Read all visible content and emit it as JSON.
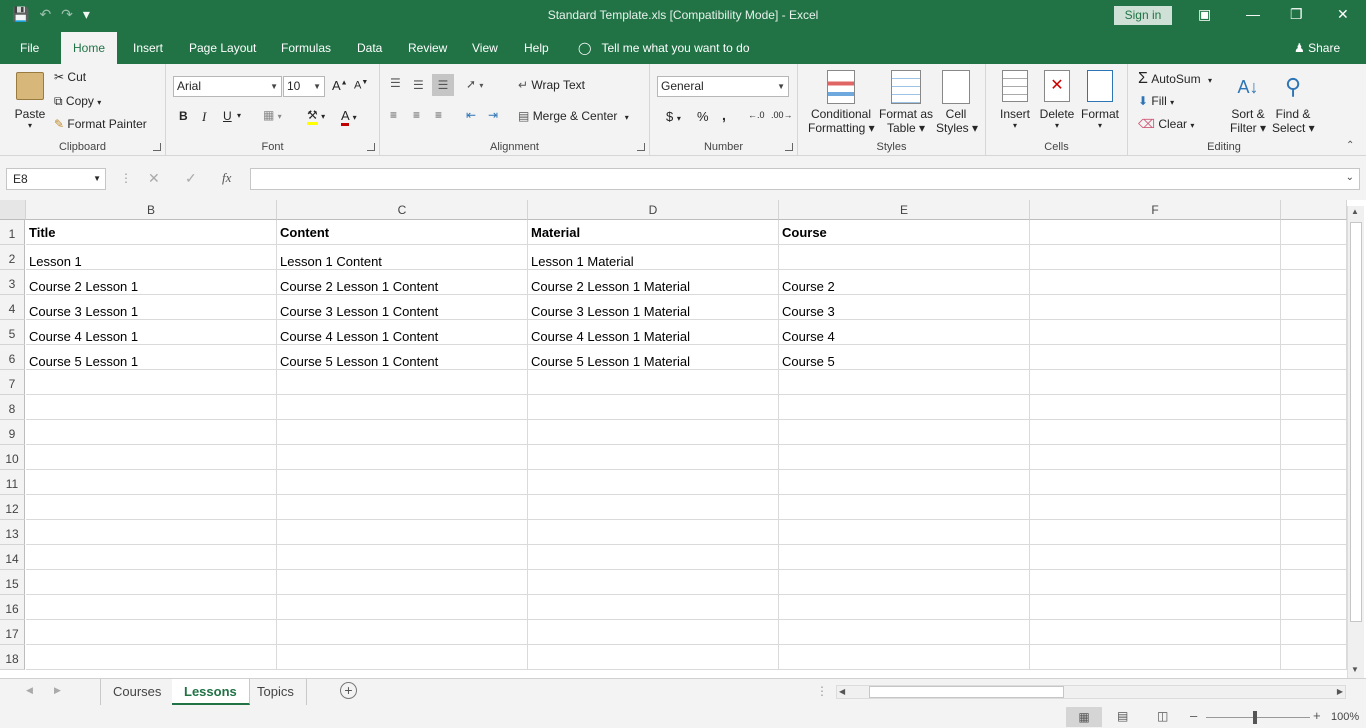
{
  "window": {
    "title": "Standard Template.xls  [Compatibility Mode]  -  Excel",
    "signin": "Sign in",
    "share": "Share",
    "accent": "#217346"
  },
  "qat": {
    "save_icon": "save-icon",
    "undo_icon": "undo-icon",
    "redo_icon": "redo-icon",
    "customize": "▾"
  },
  "menu_tabs": [
    "File",
    "Home",
    "Insert",
    "Page Layout",
    "Formulas",
    "Data",
    "Review",
    "View",
    "Help"
  ],
  "tell_me": "Tell me what you want to do",
  "ribbon": {
    "clipboard": {
      "label": "Clipboard",
      "paste": "Paste",
      "cut": "Cut",
      "copy": "Copy",
      "format_painter": "Format Painter"
    },
    "font": {
      "label": "Font",
      "name": "Arial",
      "size": "10",
      "bold": "B",
      "italic": "I",
      "underline": "U"
    },
    "alignment": {
      "label": "Alignment",
      "wrap_text": "Wrap Text",
      "merge_center": "Merge & Center"
    },
    "number": {
      "label": "Number",
      "format": "General",
      "currency": "$",
      "percent": "%",
      "comma": ","
    },
    "styles": {
      "label": "Styles",
      "conditional_formatting": [
        "Conditional",
        "Formatting ▾"
      ],
      "format_as_table": [
        "Format as",
        "Table ▾"
      ],
      "cell_styles": [
        "Cell",
        "Styles ▾"
      ]
    },
    "cells": {
      "label": "Cells",
      "insert": "Insert",
      "delete": "Delete",
      "format": "Format"
    },
    "editing": {
      "label": "Editing",
      "autosum": "AutoSum",
      "fill": "Fill",
      "clear": "Clear",
      "sort_filter": [
        "Sort &",
        "Filter ▾"
      ],
      "find_select": [
        "Find &",
        "Select ▾"
      ]
    }
  },
  "formula_bar": {
    "name_box": "E8",
    "formula": ""
  },
  "sheet": {
    "columns": [
      "B",
      "C",
      "D",
      "E",
      "F"
    ],
    "rows": [
      {
        "num": "1",
        "cells": [
          "Title",
          "Content",
          "Material",
          "Course",
          ""
        ]
      },
      {
        "num": "2",
        "cells": [
          "Lesson 1",
          "Lesson 1 Content",
          "Lesson 1 Material",
          "",
          ""
        ]
      },
      {
        "num": "3",
        "cells": [
          "Course 2 Lesson 1",
          "Course 2 Lesson 1 Content",
          "Course 2 Lesson 1 Material",
          "Course 2",
          ""
        ]
      },
      {
        "num": "4",
        "cells": [
          "Course 3 Lesson 1",
          "Course 3 Lesson 1 Content",
          "Course 3 Lesson 1 Material",
          "Course 3",
          ""
        ]
      },
      {
        "num": "5",
        "cells": [
          "Course 4 Lesson 1",
          "Course 4 Lesson 1 Content",
          "Course 4 Lesson 1 Material",
          "Course 4",
          ""
        ]
      },
      {
        "num": "6",
        "cells": [
          "Course 5 Lesson 1",
          "Course 5 Lesson 1 Content",
          "Course 5 Lesson 1 Material",
          "Course 5",
          ""
        ]
      },
      {
        "num": "7",
        "cells": [
          "",
          "",
          "",
          "",
          ""
        ]
      },
      {
        "num": "8",
        "cells": [
          "",
          "",
          "",
          "",
          ""
        ]
      },
      {
        "num": "9",
        "cells": [
          "",
          "",
          "",
          "",
          ""
        ]
      },
      {
        "num": "10",
        "cells": [
          "",
          "",
          "",
          "",
          ""
        ]
      },
      {
        "num": "11",
        "cells": [
          "",
          "",
          "",
          "",
          ""
        ]
      },
      {
        "num": "12",
        "cells": [
          "",
          "",
          "",
          "",
          ""
        ]
      },
      {
        "num": "13",
        "cells": [
          "",
          "",
          "",
          "",
          ""
        ]
      },
      {
        "num": "14",
        "cells": [
          "",
          "",
          "",
          "",
          ""
        ]
      },
      {
        "num": "15",
        "cells": [
          "",
          "",
          "",
          "",
          ""
        ]
      },
      {
        "num": "16",
        "cells": [
          "",
          "",
          "",
          "",
          ""
        ]
      },
      {
        "num": "17",
        "cells": [
          "",
          "",
          "",
          "",
          ""
        ]
      },
      {
        "num": "18",
        "cells": [
          "",
          "",
          "",
          "",
          ""
        ]
      }
    ]
  },
  "sheet_tabs": [
    "Courses",
    "Lessons",
    "Topics"
  ],
  "active_sheet": "Lessons",
  "status": {
    "zoom": "100%"
  }
}
